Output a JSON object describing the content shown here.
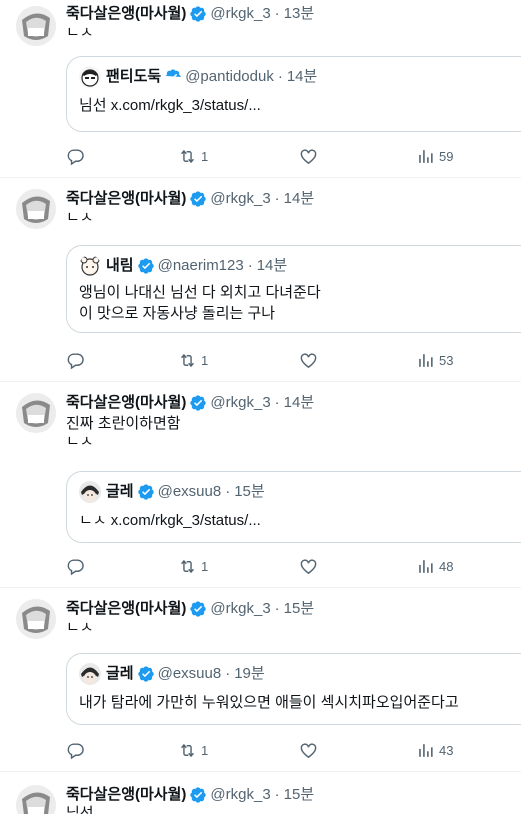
{
  "colors": {
    "text": "#0f1419",
    "secondary": "#536471",
    "border": "#cfd9de",
    "divider": "#eff3f4",
    "verified": "#1d9bf0"
  },
  "tweets": [
    {
      "author": {
        "name": "죽다살은앵(마사월)",
        "handle": "@rkgk_3",
        "time": "13분"
      },
      "text": "ㄴㅅ",
      "quote": {
        "author": {
          "name": "팬티도둑",
          "handle": "@pantidoduk",
          "time": "14분"
        },
        "text": "님선 x.com/rkgk_3/status/..."
      },
      "stats": {
        "replies": "",
        "retweets": "1",
        "likes": "",
        "views": "59"
      }
    },
    {
      "author": {
        "name": "죽다살은앵(마사월)",
        "handle": "@rkgk_3",
        "time": "14분"
      },
      "text": "ㄴㅅ",
      "quote": {
        "author": {
          "name": "내림",
          "handle": "@naerim123",
          "time": "14분"
        },
        "text": "앵님이 나대신 님선 다 외치고 다녀준다\n이 맛으로 자동사냥 돌리는 구나"
      },
      "stats": {
        "replies": "",
        "retweets": "1",
        "likes": "",
        "views": "53"
      }
    },
    {
      "author": {
        "name": "죽다살은앵(마사월)",
        "handle": "@rkgk_3",
        "time": "14분"
      },
      "text": "진짜 초란이하면함\nㄴㅅ",
      "quote": {
        "author": {
          "name": "글레",
          "handle": "@exsuu8",
          "time": "15분"
        },
        "text": "ㄴㅅ x.com/rkgk_3/status/..."
      },
      "stats": {
        "replies": "",
        "retweets": "1",
        "likes": "",
        "views": "48"
      }
    },
    {
      "author": {
        "name": "죽다살은앵(마사월)",
        "handle": "@rkgk_3",
        "time": "15분"
      },
      "text": "ㄴㅅ",
      "quote": {
        "author": {
          "name": "글레",
          "handle": "@exsuu8",
          "time": "19분"
        },
        "text": "내가 탐라에 가만히 누워있으면 애들이 섹시치파오입어준다고"
      },
      "stats": {
        "replies": "",
        "retweets": "1",
        "likes": "",
        "views": "43"
      }
    },
    {
      "author": {
        "name": "죽다살은앵(마사월)",
        "handle": "@rkgk_3",
        "time": "15분"
      },
      "text": "님선"
    }
  ],
  "icons": {
    "verified": "verified-badge-icon",
    "reply": "reply-icon",
    "retweet": "retweet-icon",
    "like": "heart-icon",
    "views": "views-chart-icon"
  }
}
